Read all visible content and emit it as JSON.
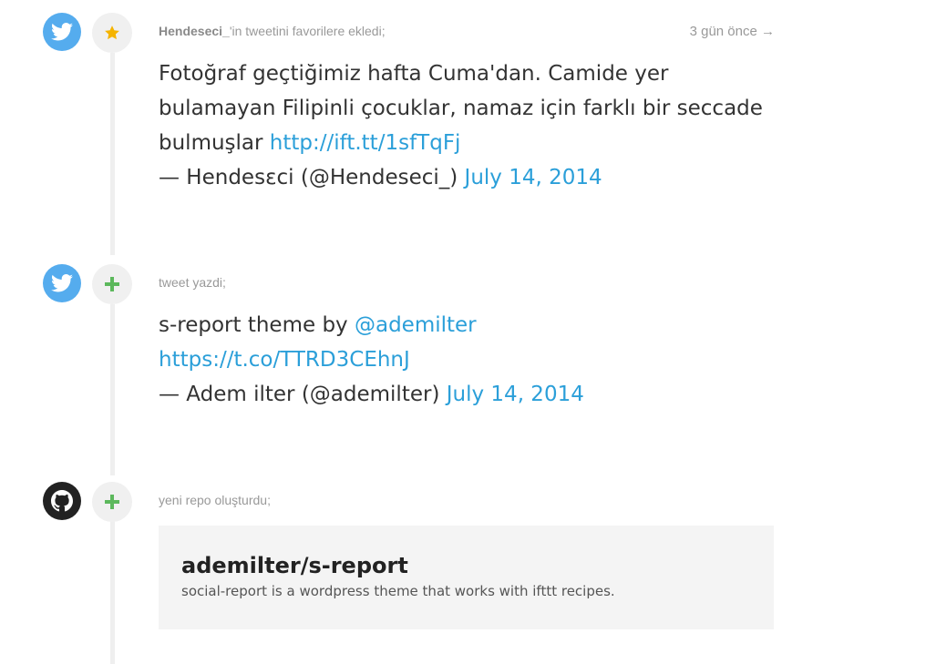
{
  "colors": {
    "twitter_blue": "#55acee",
    "github_black": "#222222",
    "star_yellow": "#f5b400",
    "plus_green": "#5cb85c",
    "link_blue": "#2b9fd9"
  },
  "entries": [
    {
      "source_icon": "twitter-icon",
      "action_icon": "star-icon",
      "meta_user": "Hendeseci_",
      "meta_text": "'in tweetini favorilere ekledi;",
      "time": "3 gün önce →",
      "tweet_text": "Fotoğraf geçtiğimiz hafta Cuma'dan. Camide yer bulamayan Filipinli çocuklar, namaz için farklı bir seccade bulmuşlar",
      "tweet_link": "http://ift.tt/1sfTqFj",
      "attribution": "— Hendesεci (@Hendeseci_)",
      "date": "July 14, 2014"
    },
    {
      "source_icon": "twitter-icon",
      "action_icon": "plus-icon",
      "meta_text": "tweet yazdi;",
      "tweet_text": "s-report theme by",
      "mention": "@ademilter",
      "tweet_link": "https://t.co/TTRD3CEhnJ",
      "attribution": "— Adem ilter (@ademilter)",
      "date": "July 14, 2014"
    },
    {
      "source_icon": "github-icon",
      "action_icon": "plus-icon",
      "meta_text": "yeni repo oluşturdu;",
      "repo_name": "ademilter/s-report",
      "repo_description": "social-report is a wordpress theme that works with ifttt recipes."
    }
  ]
}
